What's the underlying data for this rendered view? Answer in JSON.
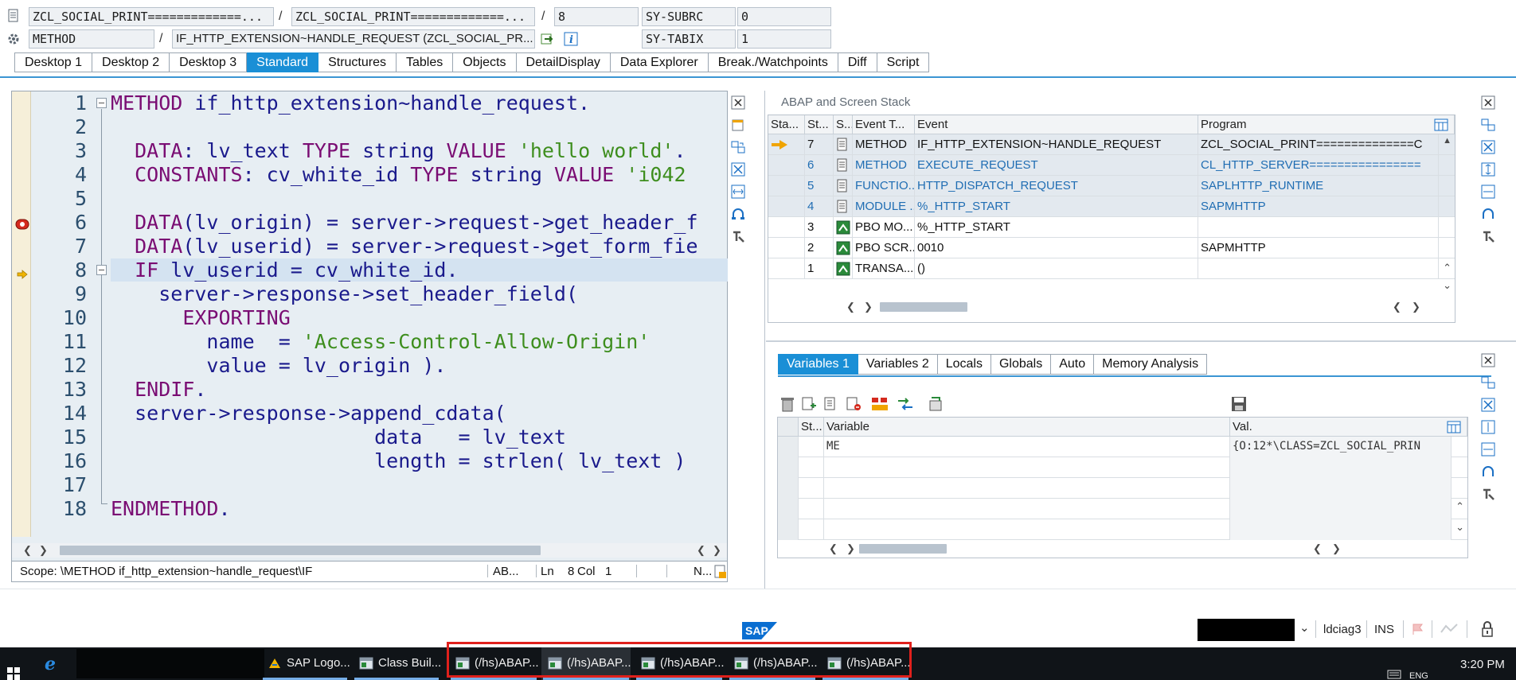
{
  "top": {
    "program1": "ZCL_SOCIAL_PRINT=============...",
    "program2": "ZCL_SOCIAL_PRINT=============...",
    "line": "8",
    "subrc_label": "SY-SUBRC",
    "subrc_value": "0",
    "event_type": "METHOD",
    "event": "IF_HTTP_EXTENSION~HANDLE_REQUEST (ZCL_SOCIAL_PR...",
    "tabix_label": "SY-TABIX",
    "tabix_value": "1",
    "slash": "/"
  },
  "tabs": [
    "Desktop 1",
    "Desktop 2",
    "Desktop 3",
    "Standard",
    "Structures",
    "Tables",
    "Objects",
    "DetailDisplay",
    "Data Explorer",
    "Break./Watchpoints",
    "Diff",
    "Script"
  ],
  "active_tab": "Standard",
  "editor": {
    "line_numbers": [
      "1",
      "2",
      "3",
      "4",
      "5",
      "6",
      "7",
      "8",
      "9",
      "10",
      "11",
      "12",
      "13",
      "14",
      "15",
      "16",
      "17",
      "18"
    ],
    "current_line": 8,
    "status": {
      "scope": "Scope: \\METHOD if_http_extension~handle_request\\IF",
      "lang": "AB...",
      "ln_label": "Ln",
      "ln_value": "8",
      "col_label": "Col",
      "col_value": "1",
      "mode": "N..."
    }
  },
  "stack": {
    "title": "ABAP and Screen Stack",
    "columns": [
      "Sta...",
      "St...",
      "S...",
      "Event T...",
      "Event",
      "Program"
    ],
    "rows": [
      {
        "level": "7",
        "type": "METHOD",
        "event": "IF_HTTP_EXTENSION~HANDLE_REQUEST",
        "program": "ZCL_SOCIAL_PRINT==============C",
        "current": true,
        "blue": false
      },
      {
        "level": "6",
        "type": "METHOD",
        "event": "EXECUTE_REQUEST",
        "program": "CL_HTTP_SERVER================",
        "current": false,
        "blue": true
      },
      {
        "level": "5",
        "type": "FUNCTIO...",
        "event": "HTTP_DISPATCH_REQUEST",
        "program": "SAPLHTTP_RUNTIME",
        "current": false,
        "blue": true
      },
      {
        "level": "4",
        "type": "MODULE ...",
        "event": "%_HTTP_START",
        "program": "SAPMHTTP",
        "current": false,
        "blue": true
      },
      {
        "level": "3",
        "type": "PBO MO...",
        "event": "%_HTTP_START",
        "program": "",
        "current": false,
        "blue": false
      },
      {
        "level": "2",
        "type": "PBO SCR...",
        "event": "0010",
        "program": "SAPMHTTP",
        "current": false,
        "blue": false
      },
      {
        "level": "1",
        "type": "TRANSA...",
        "event": "()",
        "program": "",
        "current": false,
        "blue": false
      }
    ]
  },
  "variables": {
    "tabs": [
      "Variables 1",
      "Variables 2",
      "Locals",
      "Globals",
      "Auto",
      "Memory Analysis"
    ],
    "active_tab": "Variables 1",
    "columns": [
      "St...",
      "Variable",
      "Val."
    ],
    "rows": [
      {
        "variable": "ME",
        "value": "{O:12*\\CLASS=ZCL_SOCIAL_PRIN"
      }
    ]
  },
  "footer": {
    "logo": "SAP",
    "system": "ldciag3",
    "mode": "INS"
  },
  "taskbar": {
    "items": [
      "SAP Logo...",
      "Class Buil...",
      "(/hs)ABAP...",
      "(/hs)ABAP...",
      "(/hs)ABAP...",
      "(/hs)ABAP...",
      "(/hs)ABAP..."
    ],
    "time": "3:20 PM",
    "lang": "ENG"
  },
  "colors": {
    "accent": "#1a8fd6",
    "keyword": "#7a0d73",
    "string": "#3e8e1e",
    "highlight_box": "#e0201c"
  }
}
